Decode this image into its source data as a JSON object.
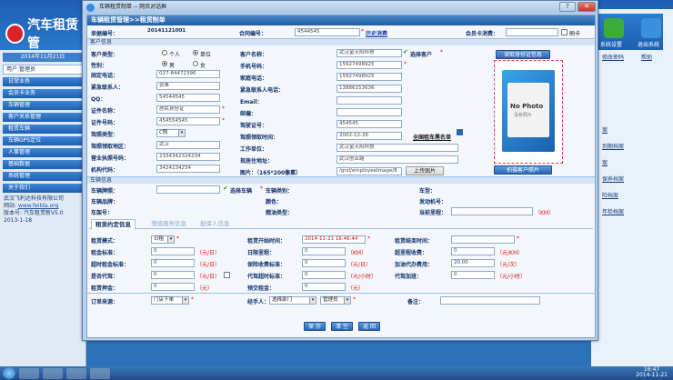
{
  "app": {
    "logo": "汽车租赁管",
    "logo_sub": "AUTO RENTAL MANAGE"
  },
  "left_panel": {
    "date": "2014年11月21日",
    "user": "用户:管理员",
    "menu": [
      "日常业务",
      "会员卡业务",
      "车辆管理",
      "客户关系管理",
      "租赁车辆",
      "车辆GPS定位",
      "人事管理",
      "基础数据",
      "系统管理",
      "关于我们"
    ],
    "company": "武汉飞利达科技有限公司",
    "website_label": "网站:",
    "website": "www.feilda.org",
    "version": "版本号: 汽车租赁新V5.0",
    "date2": "2013-1-18"
  },
  "right_panel": {
    "btn1": "系统设置",
    "btn2": "退出系统",
    "link1": "修改密码",
    "link2": "帮助",
    "items": [
      "案",
      "到期档案",
      "案",
      "保养档案",
      "险档案",
      "年检档案"
    ]
  },
  "taskbar": {
    "time": "16:47",
    "date": "2014-11-21"
  },
  "dialog": {
    "title": "车辆租赁制单 -- 网页对话框",
    "header": "车辆租赁管理>>租赁制单",
    "bill_no_label": "单据编号：",
    "bill_no": "20141121001",
    "contract_label": "合同编号：",
    "contract": "4544545",
    "history_link": "历史消费",
    "member_card_label": "会员卡消费：",
    "swipe_label": "刷卡",
    "section_customer": "客户信息",
    "cust_type_label": "客户类型：",
    "cust_type_opt1": "个人",
    "cust_type_opt2": "单位",
    "gender_label": "性别：",
    "gender_opt1": "男",
    "gender_opt2": "女",
    "phone_label": "固定电话：",
    "phone": "027-84472396",
    "emergency_contact_label": "紧急联系人：",
    "emergency_contact": "张果",
    "qq_label": "QQ：",
    "qq": "54544545",
    "id_name_label": "证件名称：",
    "id_name": "居民身份证",
    "id_no_label": "证件号码：",
    "id_no": "454554545",
    "license_type_label": "驾照类型：",
    "license_type": "C照",
    "license_place_label": "驾照领取地区：",
    "license_place": "武汉",
    "business_license_label": "营业执照号码：",
    "business_license": "2334342324234",
    "org_code_label": "机构代码：",
    "org_code": "3424234234",
    "cust_name_label": "客户名称：",
    "cust_name": "武汉金天阳科技",
    "select_customer": "选择客户",
    "mobile_label": "手机号码：",
    "mobile": "15927498925",
    "home_phone_label": "家庭电话：",
    "home_phone": "15927498925",
    "emergency_phone_label": "紧急联系人电话：",
    "emergency_phone": "13886153636",
    "email_label": "Email：",
    "mail_label": "邮编：",
    "license_no_label": "驾驶证号：",
    "license_no": "454545",
    "license_date_label": "驾照领取时间：",
    "license_date": "2002-12-26",
    "blacklist_link": "全国租车黑名单",
    "work_unit_label": "工作单位：",
    "work_unit": "武汉金天阳科技",
    "address_label": "现居住地址：",
    "address": "武汉创业路",
    "photo_label": "图片：（165*200像素）",
    "photo_path": "/grzl/employeeImage/8",
    "upload_btn": "上传图片",
    "read_id_btn": "读取身份证信息",
    "no_photo": "No Photo",
    "no_photo_sub": "没有照片",
    "capture_btn": "拍摄客户照片",
    "section_vehicle": "车辆信息",
    "plate_label": "车辆牌照：",
    "select_vehicle": "选择车辆",
    "brand_label": "车辆品牌：",
    "frame_label": "车架号：",
    "category_label": "车辆类别：",
    "color_label": "颜色：",
    "fuel_label": "燃油类型：",
    "model_label": "车型：",
    "engine_label": "发动机号：",
    "mileage_label": "当前里程：",
    "mileage_unit": "（KM）",
    "tabs": [
      "租赁约定信息",
      "增值服务信息",
      "担保人信息"
    ],
    "rent_mode_label": "租赁模式：",
    "rent_mode": "日租",
    "rent_std_label": "租金标准：",
    "rent_std": "0",
    "over_day_label": "超时租金标准：",
    "over_day": "0",
    "driver_label": "是否代驾：",
    "driver": "0",
    "deposit_label": "租赁押金：",
    "deposit": "0",
    "start_label": "租赁开始时间：",
    "start": "2014-11-21 16:46:44",
    "day_limit_label": "日限里程：",
    "day_limit": "0",
    "insurance_label": "保险收费标准：",
    "insurance": "0",
    "driver_fee_label": "代驾超时标准：",
    "driver_fee": "0",
    "pre_rent_label": "预交租金：",
    "pre_rent": "0",
    "end_label": "租赁结束时间：",
    "over_mileage_label": "超里程收费：",
    "over_mileage": "0",
    "fuel_fee_label": "加油代办费用：",
    "fuel_fee": "20.00",
    "driver_add_label": "代驾加班：",
    "driver_add": "0",
    "unit_day": "（元/日）",
    "unit_km": "（KM）",
    "unit_km2": "（元/KM）",
    "unit_yuan": "（元）",
    "unit_hour": "（元/小时）",
    "unit_time": "（元/次）",
    "source_label": "订单来源：",
    "source": "门店下单",
    "agent_label": "经手人：",
    "dept": "选择部门",
    "person": "管理员",
    "remark_label": "备注：",
    "save_btn": "保 存",
    "clear_btn": "清 空",
    "back_btn": "返 回"
  },
  "colors": {
    "accent": "#1f5ea5",
    "required": "#e01010"
  }
}
